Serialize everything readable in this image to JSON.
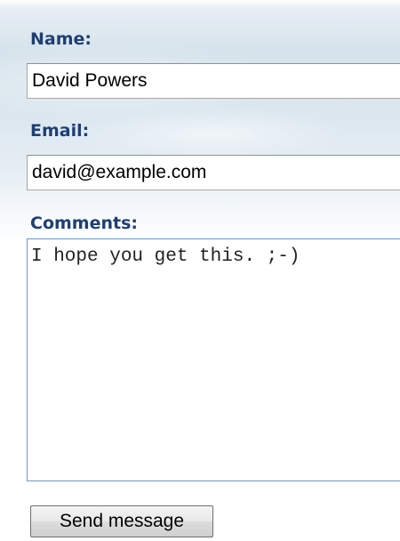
{
  "form": {
    "name": {
      "label": "Name:",
      "value": "David Powers"
    },
    "email": {
      "label": "Email:",
      "value": "david@example.com"
    },
    "comments": {
      "label": "Comments:",
      "value": "I hope you get this. ;-)"
    },
    "submit_label": "Send message"
  },
  "colors": {
    "label_text": "#1f3f73",
    "focus_border": "#6d96c9",
    "panel_background": "#d6e3ec"
  }
}
